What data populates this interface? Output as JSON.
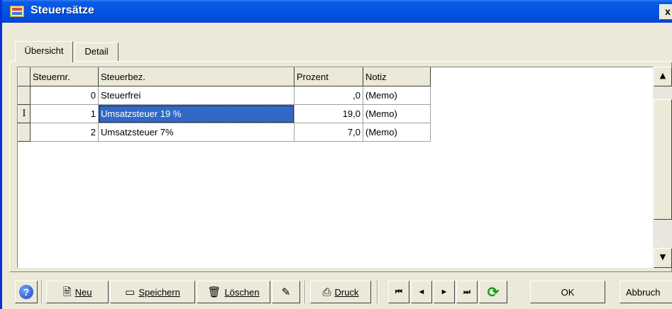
{
  "window": {
    "title": "Steuersätze",
    "close_label": "x"
  },
  "tabs": [
    {
      "label": "Übersicht",
      "active": true
    },
    {
      "label": "Detail",
      "active": false
    }
  ],
  "grid": {
    "columns": [
      "Steuernr.",
      "Steuerbez.",
      "Prozent",
      "Notiz"
    ],
    "rows": [
      {
        "indicator": "",
        "nr": "0",
        "bez": "Steuerfrei",
        "prozent": ",0",
        "notiz": "(Memo)"
      },
      {
        "indicator": "I",
        "nr": "1",
        "bez": "Umsatzsteuer 19 %",
        "prozent": "19,0",
        "notiz": "(Memo)"
      },
      {
        "indicator": "",
        "nr": "2",
        "bez": "Umsatzsteuer 7%",
        "prozent": "7,0",
        "notiz": "(Memo)"
      }
    ],
    "selected_row": 1,
    "selection_color": "#316ac5"
  },
  "scrollbar": {
    "up_icon": "▲",
    "down_icon": "▼"
  },
  "toolbar": {
    "help_icon": "?",
    "new_label": "Neu",
    "save_label": "Speichern",
    "delete_label": "Löschen",
    "print_label": "Druck",
    "first_icon": "⏮",
    "prev_icon": "◄",
    "next_icon": "►",
    "last_icon": "⏭",
    "ok_label": "OK",
    "cancel_label": "Abbruch"
  },
  "colors": {
    "titlebar": "#0255e3",
    "window_bg": "#ece9d8"
  }
}
